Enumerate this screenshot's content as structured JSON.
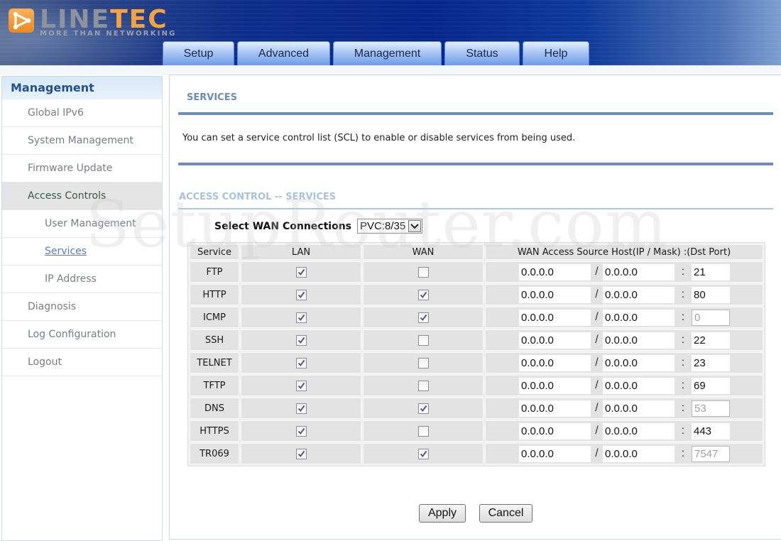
{
  "brand": {
    "name_part1": "LINE",
    "name_part2": "TEC",
    "tagline": "MORE THAN NETWORKING",
    "icon": "play-triangle-logo-icon"
  },
  "nav": {
    "tabs": [
      {
        "label": "Setup",
        "active": false
      },
      {
        "label": "Advanced",
        "active": false
      },
      {
        "label": "Management",
        "active": true
      },
      {
        "label": "Status",
        "active": false
      },
      {
        "label": "Help",
        "active": false
      }
    ]
  },
  "sidebar": {
    "title": "Management",
    "items": [
      {
        "label": "Global IPv6",
        "level": 1
      },
      {
        "label": "System Management",
        "level": 1
      },
      {
        "label": "Firmware Update",
        "level": 1
      },
      {
        "label": "Access Controls",
        "level": 1,
        "expanded": true
      },
      {
        "label": "User Management",
        "level": 2
      },
      {
        "label": "Services",
        "level": 2,
        "current": true
      },
      {
        "label": "IP Address",
        "level": 2
      },
      {
        "label": "Diagnosis",
        "level": 1
      },
      {
        "label": "Log Configuration",
        "level": 1
      },
      {
        "label": "Logout",
        "level": 1
      }
    ]
  },
  "main": {
    "section_title": "SERVICES",
    "description": "You can set a service control list (SCL) to enable or disable services from being used.",
    "sub_title": "ACCESS CONTROL -- SERVICES",
    "wan_select": {
      "label": "Select WAN Connections",
      "value": "PVC:8/35"
    },
    "table": {
      "headers": [
        "Service",
        "LAN",
        "WAN",
        "WAN Access Source Host(IP / Mask) :(Dst Port)"
      ],
      "ip_separator": "/",
      "port_separator": ":",
      "rows": [
        {
          "service": "FTP",
          "lan": true,
          "wan": false,
          "ip": "0.0.0.0",
          "mask": "0.0.0.0",
          "port": "21",
          "port_disabled": false
        },
        {
          "service": "HTTP",
          "lan": true,
          "wan": true,
          "ip": "0.0.0.0",
          "mask": "0.0.0.0",
          "port": "80",
          "port_disabled": false
        },
        {
          "service": "ICMP",
          "lan": true,
          "wan": true,
          "ip": "0.0.0.0",
          "mask": "0.0.0.0",
          "port": "0",
          "port_disabled": true
        },
        {
          "service": "SSH",
          "lan": true,
          "wan": false,
          "ip": "0.0.0.0",
          "mask": "0.0.0.0",
          "port": "22",
          "port_disabled": false
        },
        {
          "service": "TELNET",
          "lan": true,
          "wan": false,
          "ip": "0.0.0.0",
          "mask": "0.0.0.0",
          "port": "23",
          "port_disabled": false
        },
        {
          "service": "TFTP",
          "lan": true,
          "wan": false,
          "ip": "0.0.0.0",
          "mask": "0.0.0.0",
          "port": "69",
          "port_disabled": false
        },
        {
          "service": "DNS",
          "lan": true,
          "wan": true,
          "ip": "0.0.0.0",
          "mask": "0.0.0.0",
          "port": "53",
          "port_disabled": true
        },
        {
          "service": "HTTPS",
          "lan": true,
          "wan": false,
          "ip": "0.0.0.0",
          "mask": "0.0.0.0",
          "port": "443",
          "port_disabled": false
        },
        {
          "service": "TR069",
          "lan": true,
          "wan": true,
          "ip": "0.0.0.0",
          "mask": "0.0.0.0",
          "port": "7547",
          "port_disabled": true
        }
      ]
    },
    "buttons": {
      "apply": "Apply",
      "cancel": "Cancel"
    }
  },
  "watermark": "SetupRouter.com",
  "colors": {
    "header_blue": "#06258a",
    "tab_blue": "#a9c6f4",
    "logo_orange": "#f3a33f",
    "section_title": "#6c8cb3",
    "rule": "#6a8fbf",
    "sidebar_title": "#254f8c"
  }
}
